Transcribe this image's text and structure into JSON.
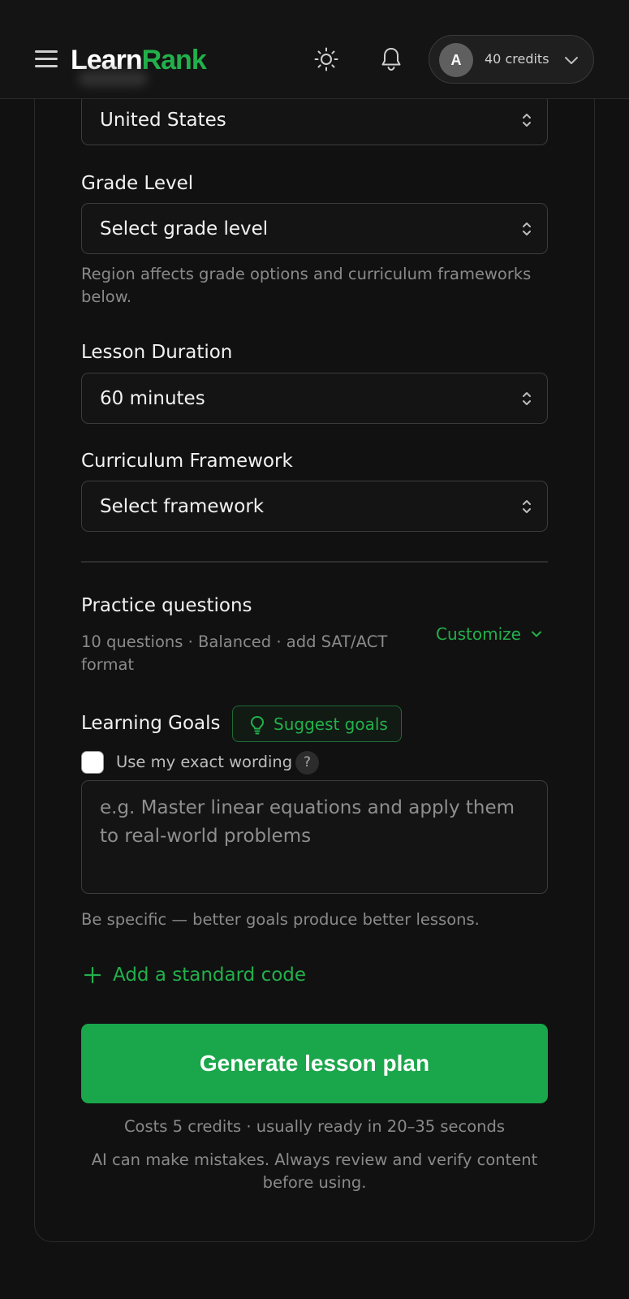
{
  "header": {
    "logo_part1": "Learn",
    "logo_part2": "Rank",
    "avatar_initial": "A",
    "credits_label": "40 credits",
    "icons": [
      "menu-icon",
      "sun-icon",
      "bell-icon",
      "chevron-down-icon"
    ]
  },
  "form": {
    "region": {
      "value": "United States"
    },
    "grade_level": {
      "label": "Grade Level",
      "value": "Select grade level"
    },
    "region_helper": "Region affects grade options and curriculum frameworks below.",
    "lesson_duration": {
      "label": "Lesson Duration",
      "value": "60 minutes"
    },
    "curriculum_framework": {
      "label": "Curriculum Framework",
      "value": "Select framework"
    },
    "practice_questions": {
      "title": "Practice questions",
      "summary": "10 questions · Balanced · add SAT/ACT format",
      "customize_label": "Customize"
    },
    "learning_goals": {
      "label": "Learning Goals",
      "suggest_label": "Suggest goals",
      "exact_wording_label": "Use my exact wording",
      "exact_wording_checked": false,
      "help_glyph": "?",
      "placeholder": "e.g. Master linear equations and apply them to real-world problems",
      "helper": "Be specific — better goals produce better lessons."
    },
    "add_standard_label": "Add a standard code",
    "generate_label": "Generate lesson plan",
    "cost_note": "Costs 5 credits · usually ready in 20–35 seconds",
    "ai_note": "AI can make mistakes. Always review and verify content before using."
  },
  "colors": {
    "background": "#111111",
    "accent": "#22b04b",
    "button": "#1aa64a",
    "border": "#3c3c3c",
    "muted_text": "#8a8a8a"
  }
}
